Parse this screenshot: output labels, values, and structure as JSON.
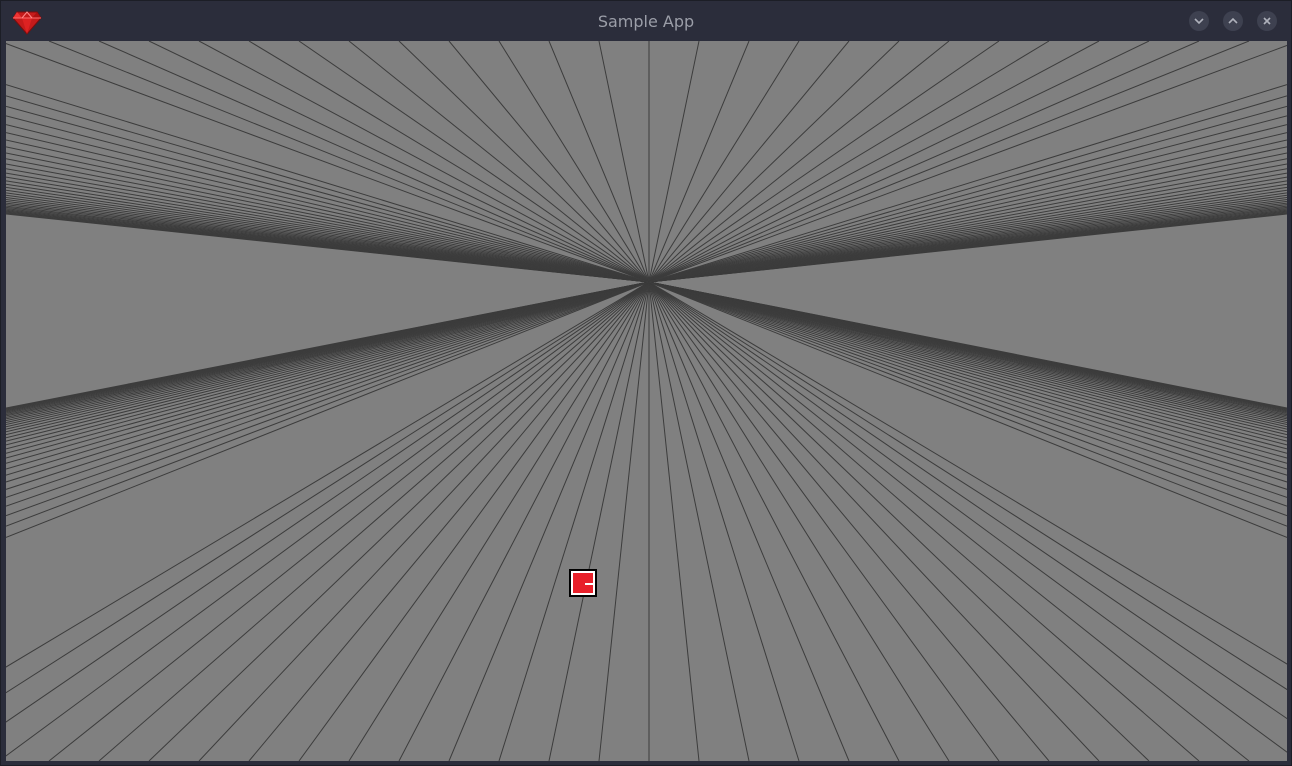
{
  "window": {
    "title": "Sample App",
    "icon": "ruby-gem-icon",
    "buttons": [
      "minimize",
      "maximize",
      "close"
    ]
  },
  "scene": {
    "background_color": "#808080",
    "line_color": "#3c3c3c",
    "player": {
      "fill_color": "#e8202a",
      "outline_color": "#000000"
    }
  }
}
